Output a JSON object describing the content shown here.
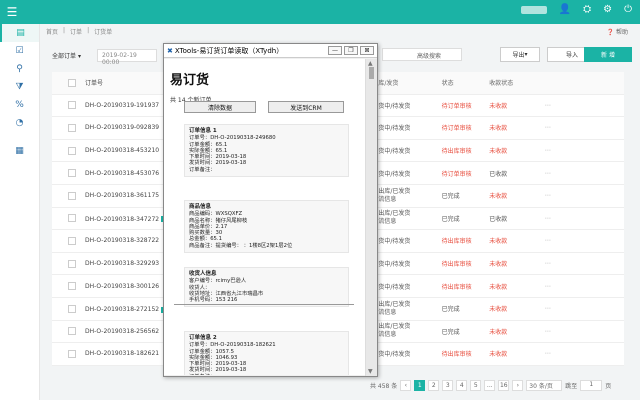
{
  "topbar": {
    "menu_icon": "hamburger-icon",
    "icons": [
      "user-icon",
      "router-icon",
      "gear-icon",
      "power-icon"
    ]
  },
  "sidebar": {
    "icons": [
      "document-icon",
      "checklist-icon",
      "user-icon",
      "filter-icon",
      "percent-icon",
      "pie-chart-icon",
      "store-icon"
    ]
  },
  "breadcrumb": [
    "首页",
    "订单",
    "订货单"
  ],
  "help": "帮助",
  "filters": {
    "all_orders": "全部订单",
    "date_value": "2019-02-19 00:00",
    "advanced_search": "高级搜索",
    "export": "导出",
    "import": "导入",
    "new": "新 增"
  },
  "table": {
    "headers": {
      "order_id": "订单号",
      "ship": "出库/发货",
      "status": "状态",
      "pay": "收款状态"
    },
    "rows": [
      {
        "id": "DH-O-20190319-191937",
        "ship": "备货中/待发货",
        "status": "待订单审核",
        "pay": "未收款",
        "status_red": true,
        "pay_red": true
      },
      {
        "id": "DH-O-20190319-092839",
        "ship": "备货中/待发货",
        "status": "待订单审核",
        "pay": "未收款",
        "status_red": true,
        "pay_red": true
      },
      {
        "id": "DH-O-20190318-453210",
        "ship": "备货中/待发货",
        "status": "待出库审核",
        "pay": "未收款",
        "status_red": true,
        "pay_red": true
      },
      {
        "id": "DH-O-20190318-453076",
        "ship": "备货中/待发货",
        "status": "待订单审核",
        "pay": "已收款",
        "status_red": true,
        "pay_red": false
      },
      {
        "id": "DH-O-20190318-361175",
        "ship": "已出库/已发货",
        "ship2": "物流信息",
        "status": "已完成",
        "pay": "未收款",
        "status_red": false,
        "pay_red": true
      },
      {
        "id": "DH-O-20190318-347272",
        "tag": "订货",
        "ship": "已出库/已发货",
        "ship2": "物流信息",
        "status": "已完成",
        "pay": "已收款",
        "status_red": false,
        "pay_red": false
      },
      {
        "id": "DH-O-20190318-328722",
        "ship": "备货中/待发货",
        "status": "待出库审核",
        "pay": "未收款",
        "status_red": true,
        "pay_red": true
      },
      {
        "id": "DH-O-20190318-329293",
        "ship": "备货中/待发货",
        "status": "待出库审核",
        "pay": "未收款",
        "status_red": true,
        "pay_red": true
      },
      {
        "id": "DH-O-20190318-300126",
        "ship": "备货中/待发货",
        "status": "待出库审核",
        "pay": "未收款",
        "status_red": true,
        "pay_red": true
      },
      {
        "id": "DH-O-20190318-272152",
        "tag": "订货",
        "ship": "已出库/已发货",
        "ship2": "物流信息",
        "status": "已完成",
        "pay": "未收款",
        "status_red": false,
        "pay_red": true
      },
      {
        "id": "DH-O-20190318-256562",
        "ship": "已出库/已发货",
        "ship2": "物流信息",
        "status": "已完成",
        "pay": "未收款",
        "status_red": false,
        "pay_red": true
      },
      {
        "id": "DH-O-20190318-182621",
        "ship": "备货中/待发货",
        "status": "待出库审核",
        "pay": "未收款",
        "status_red": true,
        "pay_red": true
      }
    ]
  },
  "pagination": {
    "total": "共 458 条",
    "pages": [
      "1",
      "2",
      "3",
      "4",
      "5",
      "...",
      "16"
    ],
    "per_page": "30 条/页",
    "goto_label": "跳至",
    "goto_value": "1",
    "goto_suffix": "页"
  },
  "popup": {
    "title": "XTools-易订货订单读取（XTydh）",
    "app_name": "易订货",
    "total": "共 14 个新订单",
    "clear_button": "清除数据",
    "send_button": "发送到CRM",
    "cards": [
      {
        "title": "订单信息 1",
        "lines": [
          "订单号：DH-O-20190318-249680",
          "订单金额：65.1",
          "实际金额：65.1",
          "下单时间：2019-03-18",
          "发货时间：2019-03-18",
          "订单备注："
        ]
      },
      {
        "title": "商品信息",
        "lines": [
          "商品编码：WXSQXFZ",
          "商品名称：猪仔风尾柳枝",
          "商品单价：2.17",
          "购买数量：30",
          "总金额：65.1",
          "商品备注：提货编号：  ：1楼8区2架1层2位"
        ]
      },
      {
        "title": "收货人信息",
        "lines": [
          "客户编号：rcimy巴逊人",
          "收货人：",
          "收货地址：江西省九江市瑞昌市",
          "手机号码：153          216"
        ]
      },
      {
        "title": "订单信息 2",
        "lines": [
          "订单号：DH-O-20190318-182621",
          "订单金额：1057.5",
          "实际金额：1046.93",
          "下单时间：2019-03-18",
          "发货时间：2019-03-18",
          "订单备注："
        ]
      }
    ]
  }
}
